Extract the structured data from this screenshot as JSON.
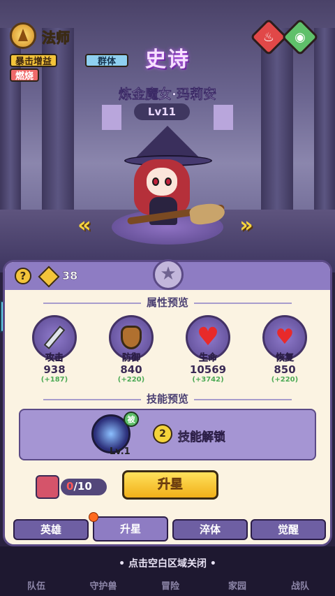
{
  "hero": {
    "class_name": "法师",
    "tags": [
      "暴击增益",
      "群体",
      "燃烧"
    ],
    "rarity": "史诗",
    "name": "炼金魔女·玛莉安",
    "level": "Lv11"
  },
  "panel": {
    "power": "38",
    "attr_title": "属性预览",
    "skill_title": "技能预览",
    "stats": [
      {
        "label": "攻击",
        "value": "938",
        "bonus": "(+187)"
      },
      {
        "label": "防御",
        "value": "840",
        "bonus": "(+220)"
      },
      {
        "label": "生命",
        "value": "10569",
        "bonus": "(+3742)"
      },
      {
        "label": "恢复",
        "value": "850",
        "bonus": "(+220)"
      }
    ],
    "skill": {
      "badge": "被",
      "level": "Lv.1",
      "unlock_num": "2",
      "unlock_text": "技能解锁"
    },
    "shards": {
      "current": "0",
      "total": "/10"
    },
    "upgrade_label": "升星",
    "tabs": [
      "英雄",
      "升星",
      "淬体",
      "觉醒"
    ]
  },
  "footer": {
    "close_hint": "• 点击空白区域关闭 •",
    "nav": [
      "队伍",
      "守护兽",
      "冒险",
      "家园",
      "战队"
    ]
  },
  "colors": {
    "accent": "#8e7cc3",
    "gold": "#f4c43a",
    "bonus_green": "#4caa55"
  }
}
